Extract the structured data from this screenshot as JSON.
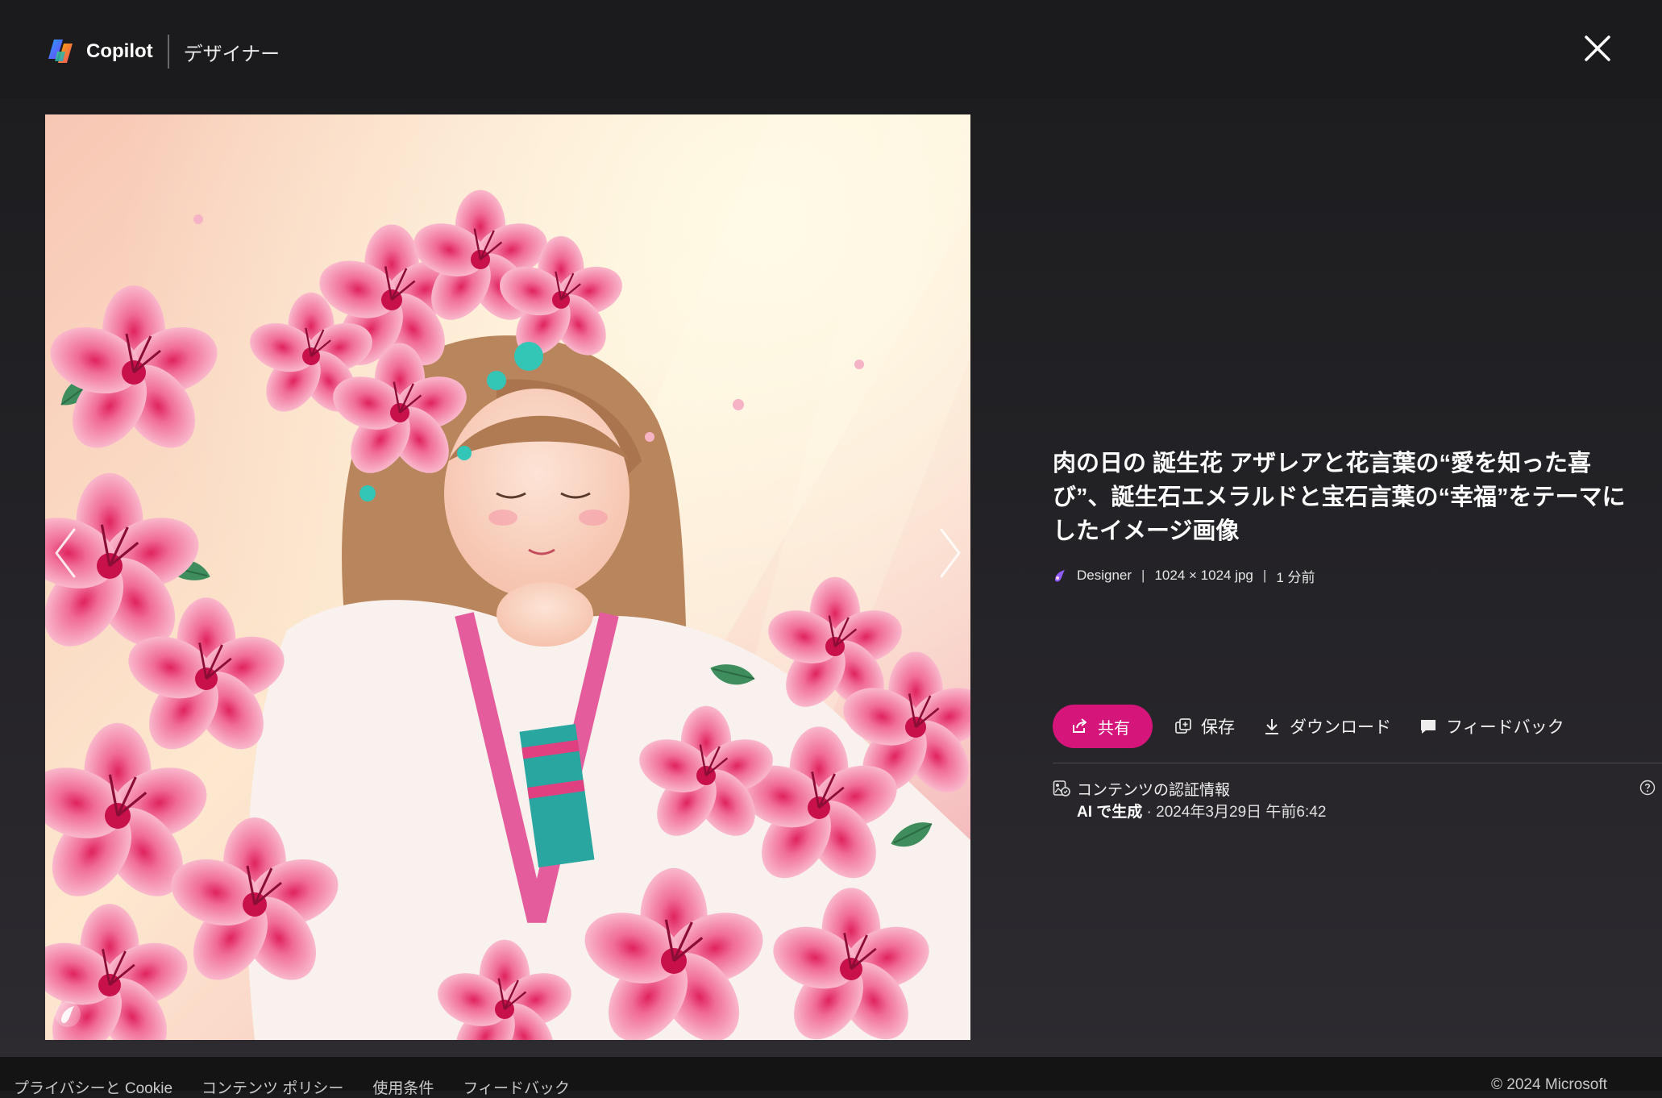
{
  "header": {
    "brand": "Copilot",
    "section": "デザイナー",
    "close_icon": "close-icon"
  },
  "image": {
    "alt": "肉の日の 誕生花 アザレアと花言葉の“愛を知った喜び”、誕生石エメラルドと宝石言葉の“幸福”をテーマにしたイメージ画像",
    "prev_icon": "chevron-left-icon",
    "next_icon": "chevron-right-icon",
    "watermark_icon": "designer-watermark-icon"
  },
  "details": {
    "title": "肉の日の 誕生花 アザレアと花言葉の“愛を知った喜び”、誕生石エメラルドと宝石言葉の“幸福”をテーマにしたイメージ画像",
    "source": "Designer",
    "dimensions": "1024 × 1024 jpg",
    "time_ago": "1 分前",
    "separator": "|"
  },
  "actions": {
    "share": "共有",
    "save": "保存",
    "download": "ダウンロード",
    "feedback": "フィードバック"
  },
  "credentials": {
    "heading": "コンテンツの認証情報",
    "ai_label": "AI で生成",
    "date": " · 2024年3月29日 午前6:42"
  },
  "footer": {
    "links": [
      "プライバシーと Cookie",
      "コンテンツ ポリシー",
      "使用条件",
      "フィードバック"
    ],
    "copyright": "© 2024 Microsoft"
  },
  "colors": {
    "background": "#1b1b1d",
    "accent": "#d6157b"
  }
}
